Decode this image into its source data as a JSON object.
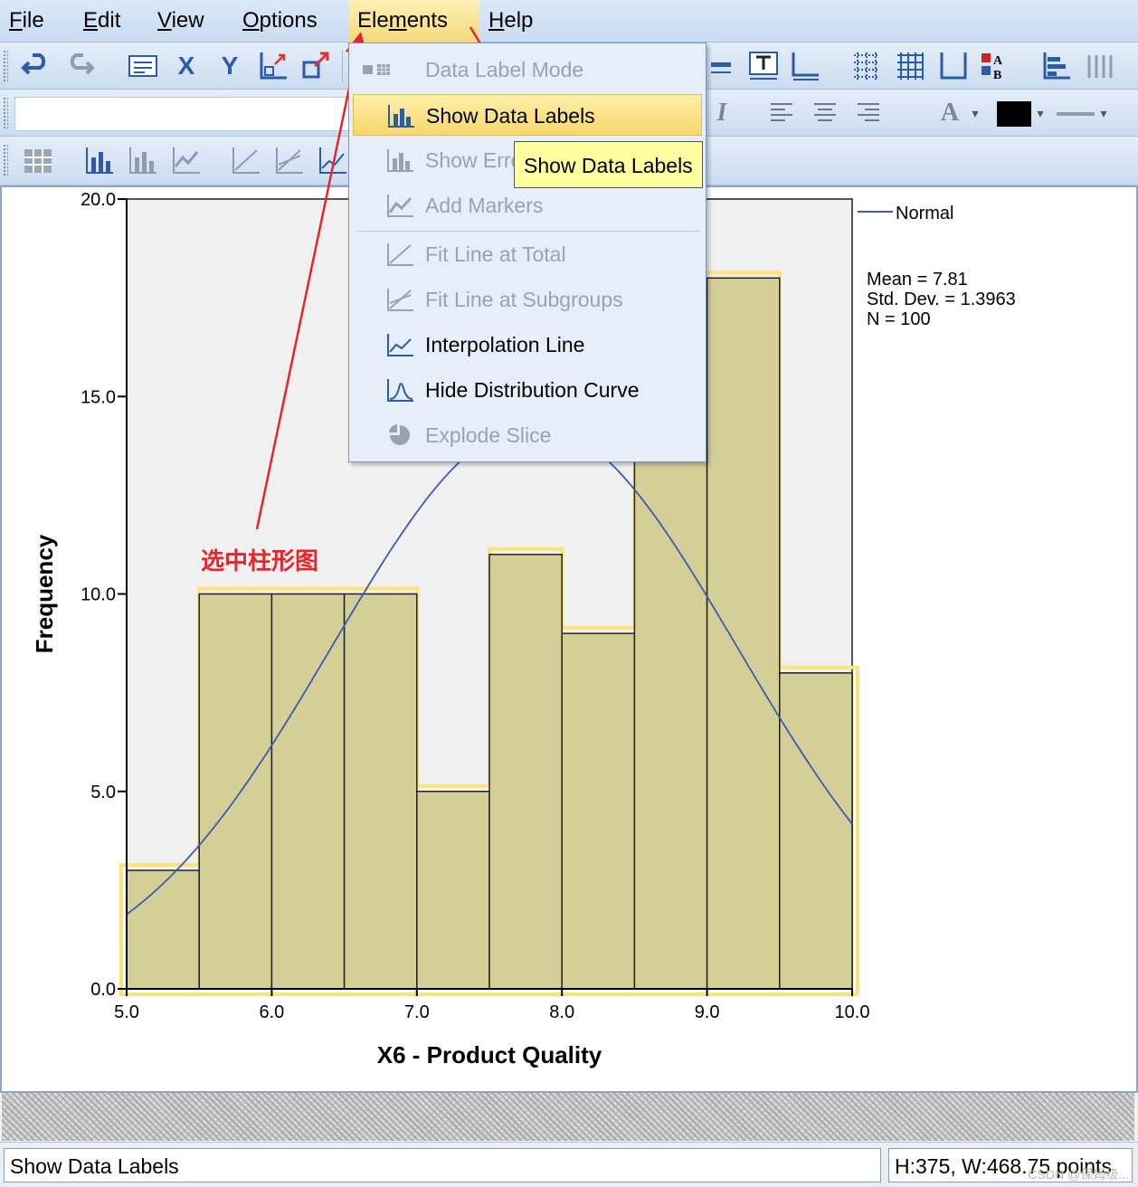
{
  "menubar": {
    "items": [
      {
        "label": "File",
        "mnemonic": "F",
        "rest": "ile"
      },
      {
        "label": "Edit",
        "mnemonic": "E",
        "rest": "dit"
      },
      {
        "label": "View",
        "mnemonic": "V",
        "rest": "iew"
      },
      {
        "label": "Options",
        "mnemonic": "O",
        "rest": "ptions"
      },
      {
        "label": "Elements",
        "pre": "Ele",
        "mnemonic": "m",
        "rest": "ents"
      },
      {
        "label": "Help",
        "mnemonic": "H",
        "rest": "elp"
      }
    ]
  },
  "toolbar": {
    "x_axis_icon": "X",
    "y_axis_icon": "Y",
    "italic_icon": "I",
    "text_color_icon": "A"
  },
  "elements_menu": {
    "items": [
      {
        "label": "Data Label Mode",
        "enabled": false,
        "icon": "data-label-mode-icon"
      },
      {
        "label": "Show Data Labels",
        "enabled": true,
        "selected": true,
        "icon": "show-data-labels-icon"
      },
      {
        "label": "Show Error Bars",
        "enabled": false,
        "icon": "error-bars-icon"
      },
      {
        "label": "Add Markers",
        "enabled": false,
        "icon": "markers-icon"
      },
      {
        "label": "Fit Line at Total",
        "enabled": false,
        "icon": "fit-line-total-icon"
      },
      {
        "label": "Fit Line at Subgroups",
        "enabled": false,
        "icon": "fit-line-subgroups-icon"
      },
      {
        "label": "Interpolation Line",
        "enabled": true,
        "icon": "interpolation-line-icon"
      },
      {
        "label": "Hide Distribution Curve",
        "enabled": true,
        "icon": "distribution-curve-icon"
      },
      {
        "label": "Explode Slice",
        "enabled": false,
        "icon": "explode-slice-icon"
      }
    ]
  },
  "tooltip": "Show Data Labels",
  "annotation": {
    "text": "选中柱形图",
    "color": "#e8242b"
  },
  "chart_data": {
    "type": "bar",
    "subtype": "histogram",
    "bin_edges": [
      5.0,
      5.5,
      6.0,
      6.5,
      7.0,
      7.5,
      8.0,
      8.5,
      9.0,
      9.5,
      10.0
    ],
    "values": [
      3,
      10,
      10,
      10,
      5,
      11,
      9,
      18,
      18,
      8
    ],
    "xlabel": "X6 - Product Quality",
    "ylabel": "Frequency",
    "xlim": [
      5.0,
      10.0
    ],
    "ylim": [
      0,
      20
    ],
    "x_ticks": [
      "5.0",
      "6.0",
      "7.0",
      "8.0",
      "9.0",
      "10.0"
    ],
    "y_ticks": [
      "0.0",
      "5.0",
      "10.0",
      "15.0",
      "20.0"
    ],
    "bar_color": "#d3cf96",
    "selection_color": "#ffe27a",
    "curve": {
      "type": "normal",
      "mean": 7.81,
      "sd": 1.3963,
      "n": 100,
      "color": "#3b5bb5"
    },
    "legend": {
      "entries": [
        "Normal"
      ],
      "position": "top-right"
    },
    "stats": [
      "Mean = 7.81",
      "Std. Dev. = 1.3963",
      "N = 100"
    ]
  },
  "statusbar": {
    "message": "Show Data Labels",
    "dimensions": "H:375, W:468.75 points"
  },
  "watermark": "CSDN @保姆级..."
}
